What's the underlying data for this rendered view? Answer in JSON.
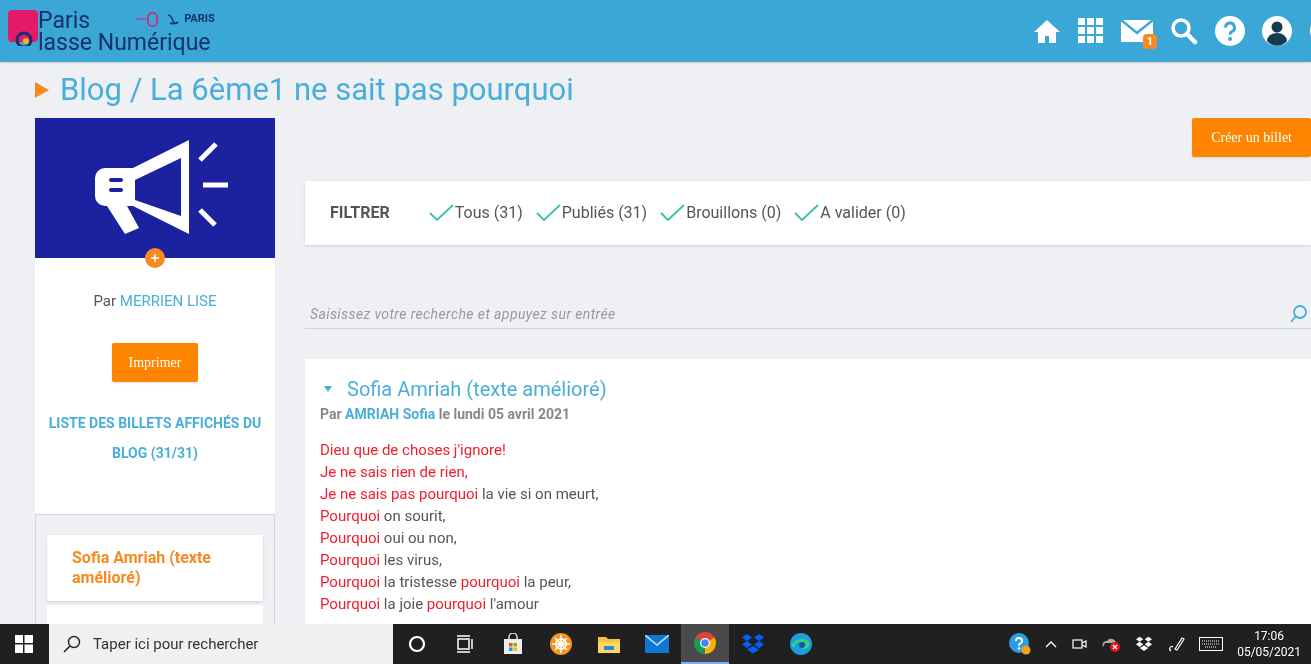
{
  "header": {
    "logo_line1": "Paris",
    "logo_line2": "lasse Numérique",
    "partner": "PARIS",
    "mail_badge": "1"
  },
  "title": {
    "prefix": "Blog / ",
    "name": "La 6ème1 ne sait pas pourquoi"
  },
  "sidebar": {
    "by_label": "Par",
    "author": "MERRIEN LISE",
    "print_button": "Imprimer",
    "list_title": "LISTE DES BILLETS AFFICHÉS DU BLOG (31/31)",
    "items": [
      {
        "label": "Sofia Amriah (texte amélioré)"
      }
    ]
  },
  "create_button": "Créer un billet",
  "filter": {
    "label": "FILTRER",
    "options": [
      {
        "label": "Tous (31)",
        "checked": true
      },
      {
        "label": "Publiés (31)",
        "checked": true
      },
      {
        "label": "Brouillons (0)",
        "checked": true
      },
      {
        "label": "A valider (0)",
        "checked": true
      }
    ]
  },
  "search": {
    "placeholder": "Saisissez votre recherche et appuyez sur entrée"
  },
  "post": {
    "title": "Sofia Amriah (texte amélioré)",
    "expanded": true,
    "by_label": "Par",
    "author": "AMRIAH Sofia",
    "date": "le lundi 05 avril 2021",
    "lines": [
      [
        {
          "text": "Dieu que de choses j'ignore!",
          "red": true
        }
      ],
      [
        {
          "text": "Je ne sais rien de rien,",
          "red": true
        }
      ],
      [
        {
          "text": "Je ne sais pas pourquoi",
          "red": true
        },
        {
          "text": " la vie si on meurt,",
          "red": false
        }
      ],
      [
        {
          "text": "Pourquoi",
          "red": true
        },
        {
          "text": " on sourit,",
          "red": false
        }
      ],
      [
        {
          "text": "Pourquoi",
          "red": true
        },
        {
          "text": " oui ou non,",
          "red": false
        }
      ],
      [
        {
          "text": "Pourquoi",
          "red": true
        },
        {
          "text": " les virus,",
          "red": false
        }
      ],
      [
        {
          "text": "Pourquoi",
          "red": true
        },
        {
          "text": " la tristesse ",
          "red": false
        },
        {
          "text": "pourquoi",
          "red": true
        },
        {
          "text": " la peur,",
          "red": false
        }
      ],
      [
        {
          "text": "Pourquoi",
          "red": true
        },
        {
          "text": " la joie ",
          "red": false
        },
        {
          "text": "pourquoi",
          "red": true
        },
        {
          "text": " l'amour",
          "red": false
        }
      ]
    ]
  },
  "taskbar": {
    "search_placeholder": "Taper ici pour rechercher",
    "apps": [
      {
        "kind": "cortana",
        "selected": false
      },
      {
        "kind": "taskview",
        "selected": false
      },
      {
        "kind": "store",
        "selected": false
      },
      {
        "kind": "orange",
        "selected": false
      },
      {
        "kind": "folder",
        "selected": false
      },
      {
        "kind": "mail",
        "selected": false
      },
      {
        "kind": "chrome",
        "selected": true
      },
      {
        "kind": "dropbox",
        "selected": false
      },
      {
        "kind": "edge",
        "selected": false
      }
    ],
    "time": "17:06",
    "date": "05/05/2021"
  }
}
